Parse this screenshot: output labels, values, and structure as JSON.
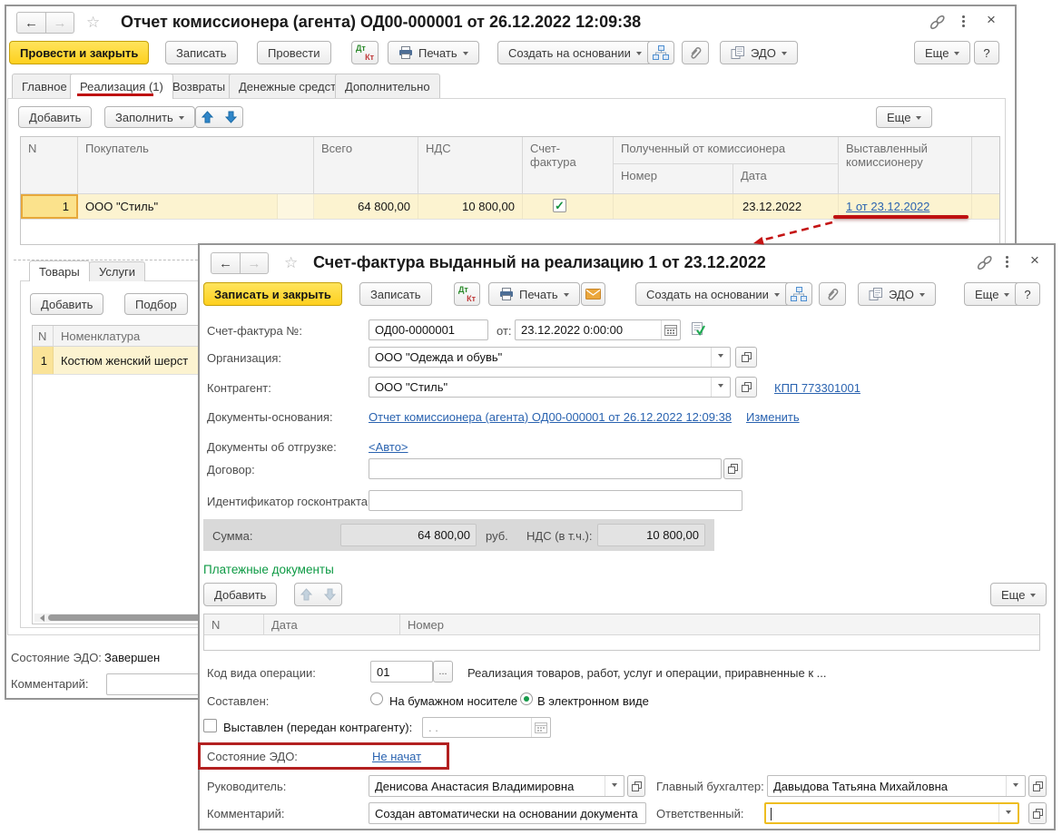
{
  "icons": {
    "back": "←",
    "forward": "→",
    "star": "☆",
    "close": "×",
    "dt": "Дт",
    "kt": "Кт",
    "ellipsis": "..."
  },
  "colors": {
    "accent_yellow": "#fed01e",
    "annotation_red": "#bf1111",
    "section_green": "#0d9a44",
    "link_blue": "#2a63b0",
    "row_yellow": "#fcf3d0",
    "focus_orange": "#eebd20"
  },
  "back_window": {
    "title": "Отчет комиссионера (агента) ОД00-000001 от 26.12.2022 12:09:38",
    "commands": {
      "post_close": "Провести и закрыть",
      "save": "Записать",
      "post": "Провести",
      "print": "Печать",
      "create_on_basis": "Создать на основании",
      "edo": "ЭДО",
      "more": "Еще",
      "help": "?"
    },
    "tabs": [
      {
        "label": "Главное"
      },
      {
        "label": "Реализация (1)"
      },
      {
        "label": "Возвраты"
      },
      {
        "label": "Денежные средства"
      },
      {
        "label": "Дополнительно"
      }
    ],
    "grid_commands": {
      "add": "Добавить",
      "fill": "Заполнить",
      "more": "Еще"
    },
    "grid": {
      "col_n": "N",
      "col_buyer": "Покупатель",
      "col_total": "Всего",
      "col_vat": "НДС",
      "col_invoice": "Счет-фактура",
      "col_received": "Полученный от комиссионера",
      "col_number": "Номер",
      "col_date": "Дата",
      "col_issued": "Выставленный комиссионеру",
      "row": {
        "n": "1",
        "buyer": "ООО \"Стиль\"",
        "total": "64 800,00",
        "vat": "10 800,00",
        "date": "23.12.2022",
        "issued_link": "1 от 23.12.2022"
      }
    },
    "items": {
      "tab_goods": "Товары",
      "tab_services": "Услуги",
      "add": "Добавить",
      "pick": "Подбор",
      "col_n": "N",
      "col_nomenclature": "Номенклатура",
      "row": {
        "n": "1",
        "name": "Костюм женский шерст"
      }
    },
    "footer": {
      "edo_label": "Состояние ЭДО:",
      "edo_value": "Завершен",
      "comment_label": "Комментарий:"
    }
  },
  "front_window": {
    "title": "Счет-фактура выданный на реализацию 1 от 23.12.2022",
    "commands": {
      "save_close": "Записать и закрыть",
      "save": "Записать",
      "print": "Печать",
      "create_on_basis": "Создать на основании",
      "edo": "ЭДО",
      "more": "Еще",
      "help": "?"
    },
    "form": {
      "number_label": "Счет-фактура №:",
      "number": "ОД00-0000001",
      "from_label": "от:",
      "date": "23.12.2022 0:00:00",
      "org_label": "Организация:",
      "org": "ООО \"Одежда и обувь\"",
      "contractor_label": "Контрагент:",
      "contractor": "ООО \"Стиль\"",
      "kpp_link": "КПП 773301001",
      "basis_label": "Документы-основания:",
      "basis_link": "Отчет комиссионера (агента) ОД00-000001 от 26.12.2022 12:09:38",
      "change_link": "Изменить",
      "shipment_label": "Документы об отгрузке:",
      "shipment_link": "<Авто>",
      "contract_label": "Договор:",
      "gov_contract_label": "Идентификатор госконтракта:",
      "sum_label": "Сумма:",
      "sum": "64 800,00",
      "rub": "руб.",
      "vat_label": "НДС (в т.ч.):",
      "vat": "10 800,00"
    },
    "payment_docs": {
      "title": "Платежные документы",
      "add": "Добавить",
      "more": "Еще",
      "col_n": "N",
      "col_date": "Дата",
      "col_number": "Номер"
    },
    "op": {
      "label": "Код вида операции:",
      "code": "01",
      "desc": "Реализация товаров, работ, услуг и операции, приравненные к ..."
    },
    "composed": {
      "label": "Составлен:",
      "paper": "На бумажном носителе",
      "electronic": "В электронном виде"
    },
    "issued": {
      "label": "Выставлен (передан контрагенту):",
      "placeholder": ".  ."
    },
    "edo": {
      "label": "Состояние ЭДО:",
      "value_link": "Не начат"
    },
    "footer": {
      "manager_label": "Руководитель:",
      "manager": "Денисова Анастасия Владимировна",
      "accountant_label": "Главный бухгалтер:",
      "accountant": "Давыдова Татьяна Михайловна",
      "comment_label": "Комментарий:",
      "comment": "Создан автоматически на основании документа",
      "responsible_label": "Ответственный:"
    }
  }
}
